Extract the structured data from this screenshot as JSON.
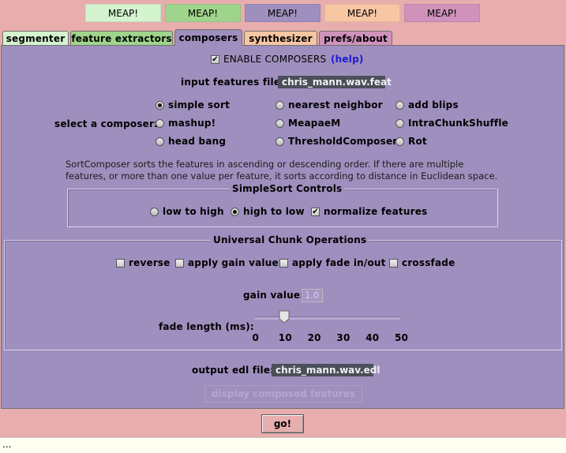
{
  "meap_buttons": [
    {
      "label": "MEAP!",
      "color": "#d4f3cf"
    },
    {
      "label": "MEAP!",
      "color": "#9fd48c"
    },
    {
      "label": "MEAP!",
      "color": "#9f8fbe"
    },
    {
      "label": "MEAP!",
      "color": "#f7c6a3"
    },
    {
      "label": "MEAP!",
      "color": "#cf92bb"
    }
  ],
  "tabs": [
    {
      "label": "segmenter",
      "color": "#d4f3cf"
    },
    {
      "label": "feature extractors",
      "color": "#9fd48c"
    },
    {
      "label": "composers",
      "color": "#9f8fbe"
    },
    {
      "label": "synthesizer",
      "color": "#f7c6a3"
    },
    {
      "label": "prefs/about",
      "color": "#cf92bb"
    }
  ],
  "active_tab": "composers",
  "enable": {
    "label": "ENABLE COMPOSERS",
    "checked": true,
    "help": "(help)"
  },
  "input_features": {
    "label": "input features file:",
    "value": "chris_mann.wav.feat"
  },
  "composer": {
    "label": "select a composer:",
    "options": [
      "simple sort",
      "nearest neighbor",
      "add blips",
      "mashup!",
      "MeapaeM",
      "IntraChunkShuffle",
      "head bang",
      "ThresholdComposer",
      "Rot"
    ],
    "selected": "simple sort"
  },
  "description": [
    "SortComposer sorts the features in ascending or descending order. If there are multiple",
    "features, or more than one value per feature, it sorts according to distance in Euclidean space."
  ],
  "simplesort": {
    "title": "SimpleSort Controls",
    "options": [
      "low to high",
      "high to low"
    ],
    "selected": "high to low",
    "normalize": {
      "label": "normalize features",
      "checked": true
    }
  },
  "chunk_ops": {
    "title": "Universal Chunk Operations",
    "checks": [
      {
        "label": "reverse",
        "checked": false
      },
      {
        "label": "apply gain value",
        "checked": false
      },
      {
        "label": "apply fade in/out",
        "checked": false
      },
      {
        "label": "crossfade",
        "checked": false
      }
    ],
    "gain_label": "gain value:",
    "gain_value": "1.0",
    "fade_label": "fade length (ms):",
    "fade_ticks": [
      "0",
      "10",
      "20",
      "30",
      "40",
      "50"
    ],
    "fade_value": 10
  },
  "output_edl": {
    "label": "output edl file:",
    "value": "chris_mann.wav.edl"
  },
  "display_button": "display composed features",
  "go_button": "go!",
  "status": "..."
}
